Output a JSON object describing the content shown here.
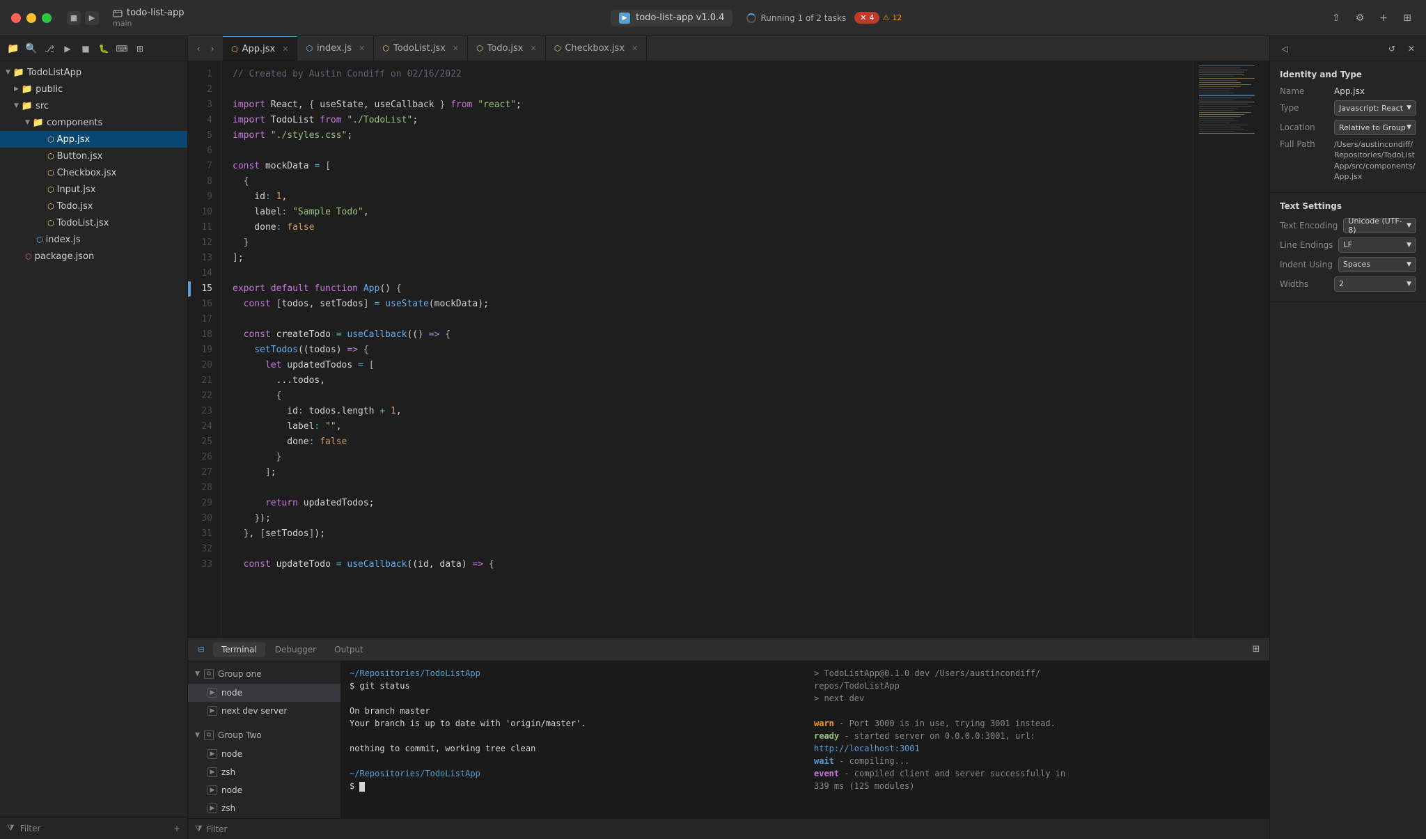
{
  "window": {
    "title": "todo-list-app",
    "branch": "main",
    "app_title": "todo-list-app v1.0.4",
    "running_label": "Running 1 of 2 tasks",
    "errors": "4",
    "warnings": "12"
  },
  "titlebar": {
    "traffic": [
      "close",
      "minimize",
      "maximize"
    ],
    "controls": [
      "stop",
      "play"
    ],
    "nav_btns": [
      "←",
      "→"
    ],
    "plus_btn": "+",
    "layout_btn": "⊞"
  },
  "sidebar": {
    "toolbar_icons": [
      "folder",
      "search",
      "branch",
      "play",
      "stop",
      "debug",
      "term",
      "split"
    ],
    "tree": [
      {
        "label": "TodoListApp",
        "type": "folder",
        "depth": 0,
        "open": true
      },
      {
        "label": "public",
        "type": "folder",
        "depth": 1,
        "open": true
      },
      {
        "label": "src",
        "type": "folder",
        "depth": 1,
        "open": true
      },
      {
        "label": "components",
        "type": "folder",
        "depth": 2,
        "open": true
      },
      {
        "label": "App.jsx",
        "type": "file-js",
        "depth": 3,
        "active": true
      },
      {
        "label": "Button.jsx",
        "type": "file-js",
        "depth": 3
      },
      {
        "label": "Checkbox.jsx",
        "type": "file-js",
        "depth": 3
      },
      {
        "label": "Input.jsx",
        "type": "file-js",
        "depth": 3
      },
      {
        "label": "Todo.jsx",
        "type": "file-js",
        "depth": 3
      },
      {
        "label": "TodoList.jsx",
        "type": "file-js",
        "depth": 3
      },
      {
        "label": "index.js",
        "type": "file-js",
        "depth": 2
      },
      {
        "label": "package.json",
        "type": "file-json",
        "depth": 1
      }
    ],
    "filter_placeholder": "Filter"
  },
  "tabs": [
    {
      "label": "App.jsx",
      "active": true,
      "icon": "js"
    },
    {
      "label": "index.js",
      "active": false,
      "icon": "js"
    },
    {
      "label": "TodoList.jsx",
      "active": false,
      "icon": "js"
    },
    {
      "label": "Todo.jsx",
      "active": false,
      "icon": "js"
    },
    {
      "label": "Checkbox.jsx",
      "active": false,
      "icon": "js"
    }
  ],
  "code": {
    "filename": "App.jsx",
    "lines": [
      {
        "num": 1,
        "content": "comment",
        "text": "// Created by Austin Condiff on 02/16/2022"
      },
      {
        "num": 2,
        "content": "empty",
        "text": ""
      },
      {
        "num": 3,
        "content": "import",
        "text": "import React, { useState, useCallback } from \"react\";"
      },
      {
        "num": 4,
        "content": "import",
        "text": "import TodoList from \"./TodoList\";"
      },
      {
        "num": 5,
        "content": "import",
        "text": "import \"./styles.css\";"
      },
      {
        "num": 6,
        "content": "empty",
        "text": ""
      },
      {
        "num": 7,
        "content": "code",
        "text": "const mockData = ["
      },
      {
        "num": 8,
        "content": "code",
        "text": "  {"
      },
      {
        "num": 9,
        "content": "code",
        "text": "    id: 1,"
      },
      {
        "num": 10,
        "content": "code",
        "text": "    label: \"Sample Todo\","
      },
      {
        "num": 11,
        "content": "code",
        "text": "    done: false"
      },
      {
        "num": 12,
        "content": "code",
        "text": "  }"
      },
      {
        "num": 13,
        "content": "code",
        "text": "];"
      },
      {
        "num": 14,
        "content": "empty",
        "text": ""
      },
      {
        "num": 15,
        "content": "code",
        "text": "export default function App() {"
      },
      {
        "num": 16,
        "content": "code",
        "text": "  const [todos, setTodos] = useState(mockData);"
      },
      {
        "num": 17,
        "content": "empty",
        "text": ""
      },
      {
        "num": 18,
        "content": "code",
        "text": "  const createTodo = useCallback(() => {"
      },
      {
        "num": 19,
        "content": "code",
        "text": "    setTodos((todos) => {"
      },
      {
        "num": 20,
        "content": "code",
        "text": "      let updatedTodos = ["
      },
      {
        "num": 21,
        "content": "code",
        "text": "        ...todos,"
      },
      {
        "num": 22,
        "content": "code",
        "text": "        {"
      },
      {
        "num": 23,
        "content": "code",
        "text": "          id: todos.length + 1,"
      },
      {
        "num": 24,
        "content": "code",
        "text": "          label: \"\","
      },
      {
        "num": 25,
        "content": "code",
        "text": "          done: false"
      },
      {
        "num": 26,
        "content": "code",
        "text": "        }"
      },
      {
        "num": 27,
        "content": "code",
        "text": "      ];"
      },
      {
        "num": 28,
        "content": "empty",
        "text": ""
      },
      {
        "num": 29,
        "content": "code",
        "text": "      return updatedTodos;"
      },
      {
        "num": 30,
        "content": "code",
        "text": "    });"
      },
      {
        "num": 31,
        "content": "code",
        "text": "  }, [setTodos]);"
      },
      {
        "num": 32,
        "content": "empty",
        "text": ""
      },
      {
        "num": 33,
        "content": "code",
        "text": "  const updateTodo = useCallback((id, data) => {"
      }
    ],
    "active_line": 15,
    "highlight_lines": [
      15
    ]
  },
  "terminal": {
    "tabs": [
      "Terminal",
      "Debugger",
      "Output"
    ],
    "active_tab": "Terminal",
    "groups": [
      {
        "label": "Group one",
        "open": true,
        "items": [
          {
            "label": "node",
            "active": true
          },
          {
            "label": "next dev server",
            "active": false
          }
        ]
      },
      {
        "label": "Group Two",
        "open": true,
        "items": [
          {
            "label": "node",
            "active": false
          },
          {
            "label": "zsh",
            "active": false
          },
          {
            "label": "node",
            "active": false
          },
          {
            "label": "zsh",
            "active": false
          }
        ]
      }
    ],
    "left_output": [
      "~/Repositories/TodoListApp",
      "$ git status",
      "",
      "On branch master",
      "Your branch is up to date with 'origin/master'.",
      "",
      "nothing to commit, working tree clean",
      "",
      "~/Repositories/TodoListApp",
      "$ "
    ],
    "right_output": [
      "> TodoListApp@0.1.0 dev /Users/austincondiff/",
      "repos/TodoListApp",
      "> next dev",
      "",
      "warn - Port 3000 is in use, trying 3001 instead.",
      "ready - started server on 0.0.0.0:3001, url:",
      "http://localhost:3001",
      "wait - compiling...",
      "event - compiled client and server successfully in",
      "339 ms (125 modules)"
    ],
    "filter_placeholder": "Filter"
  },
  "inspector": {
    "title": "Identity and Type",
    "fields": [
      {
        "label": "Name",
        "value": "App.jsx"
      },
      {
        "label": "Type",
        "value": "Javascript: React"
      },
      {
        "label": "Location",
        "value": "Relative to Group"
      },
      {
        "label": "Full Path",
        "value": "/Users/austincondiff/Repositories/TodoListApp/src/components/App.jsx"
      }
    ],
    "text_settings_title": "Text Settings",
    "text_settings": [
      {
        "label": "Text Encoding",
        "value": "Unicode (UTF-8)"
      },
      {
        "label": "Line Endings",
        "value": "LF"
      },
      {
        "label": "Indent Using",
        "value": "Spaces"
      },
      {
        "label": "Widths",
        "value": "2"
      }
    ]
  },
  "colors": {
    "accent": "#5a9fd4",
    "bg_dark": "#1e1e1e",
    "bg_mid": "#252525",
    "bg_panel": "#2d2d2d",
    "border": "#1a1a1a",
    "text_primary": "#d4d4d4",
    "text_muted": "#888888",
    "active_tab_border": "#5a9fd4",
    "warn_color": "#f39c12",
    "error_color": "#e06c75",
    "ready_color": "#98c379"
  }
}
